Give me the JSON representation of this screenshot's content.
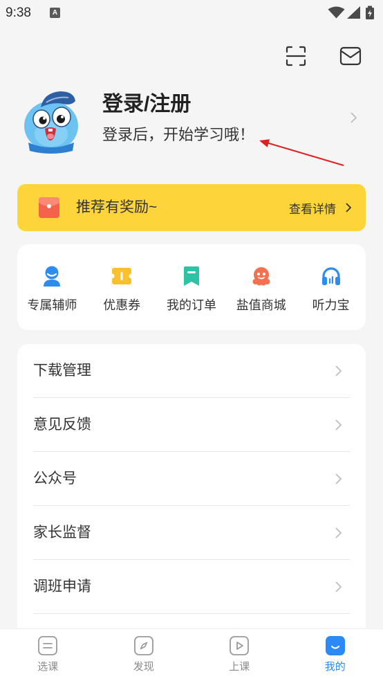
{
  "status_bar": {
    "time": "9:38",
    "notif_glyph": "A",
    "icons": [
      "wifi-icon",
      "signal-icon",
      "battery-icon"
    ]
  },
  "header": {
    "scan_icon": "scan-icon",
    "mail_icon": "mail-icon"
  },
  "profile": {
    "title": "登录/注册",
    "subtitle": "登录后，开始学习哦！",
    "avatar_icon": "mascot-avatar"
  },
  "annotation": {
    "type": "arrow",
    "color": "#E02020"
  },
  "banner": {
    "label": "推荐有奖励~",
    "action": "查看详情",
    "icon": "red-envelope-icon",
    "bg_color": "#FDD43A"
  },
  "features": [
    {
      "label": "专属辅师",
      "icon": "tutor-icon",
      "color": "#2D8CF0"
    },
    {
      "label": "优惠券",
      "icon": "coupon-icon",
      "color": "#FBC02D"
    },
    {
      "label": "我的订单",
      "icon": "orders-icon",
      "color": "#2DC3A4"
    },
    {
      "label": "盐值商城",
      "icon": "mall-icon",
      "color": "#F5704F"
    },
    {
      "label": "听力宝",
      "icon": "headphones-icon",
      "color": "#2D8CF0"
    }
  ],
  "menu": [
    {
      "label": "下载管理"
    },
    {
      "label": "意见反馈"
    },
    {
      "label": "公众号"
    },
    {
      "label": "家长监督"
    },
    {
      "label": "调班申请"
    }
  ],
  "tabbar": {
    "active_color": "#2B8AF7",
    "inactive_color": "#8A8A8A",
    "items": [
      {
        "label": "选课",
        "icon": "course-icon",
        "active": false
      },
      {
        "label": "发现",
        "icon": "discover-icon",
        "active": false
      },
      {
        "label": "上课",
        "icon": "class-icon",
        "active": false
      },
      {
        "label": "我的",
        "icon": "profile-icon",
        "active": true
      }
    ]
  }
}
